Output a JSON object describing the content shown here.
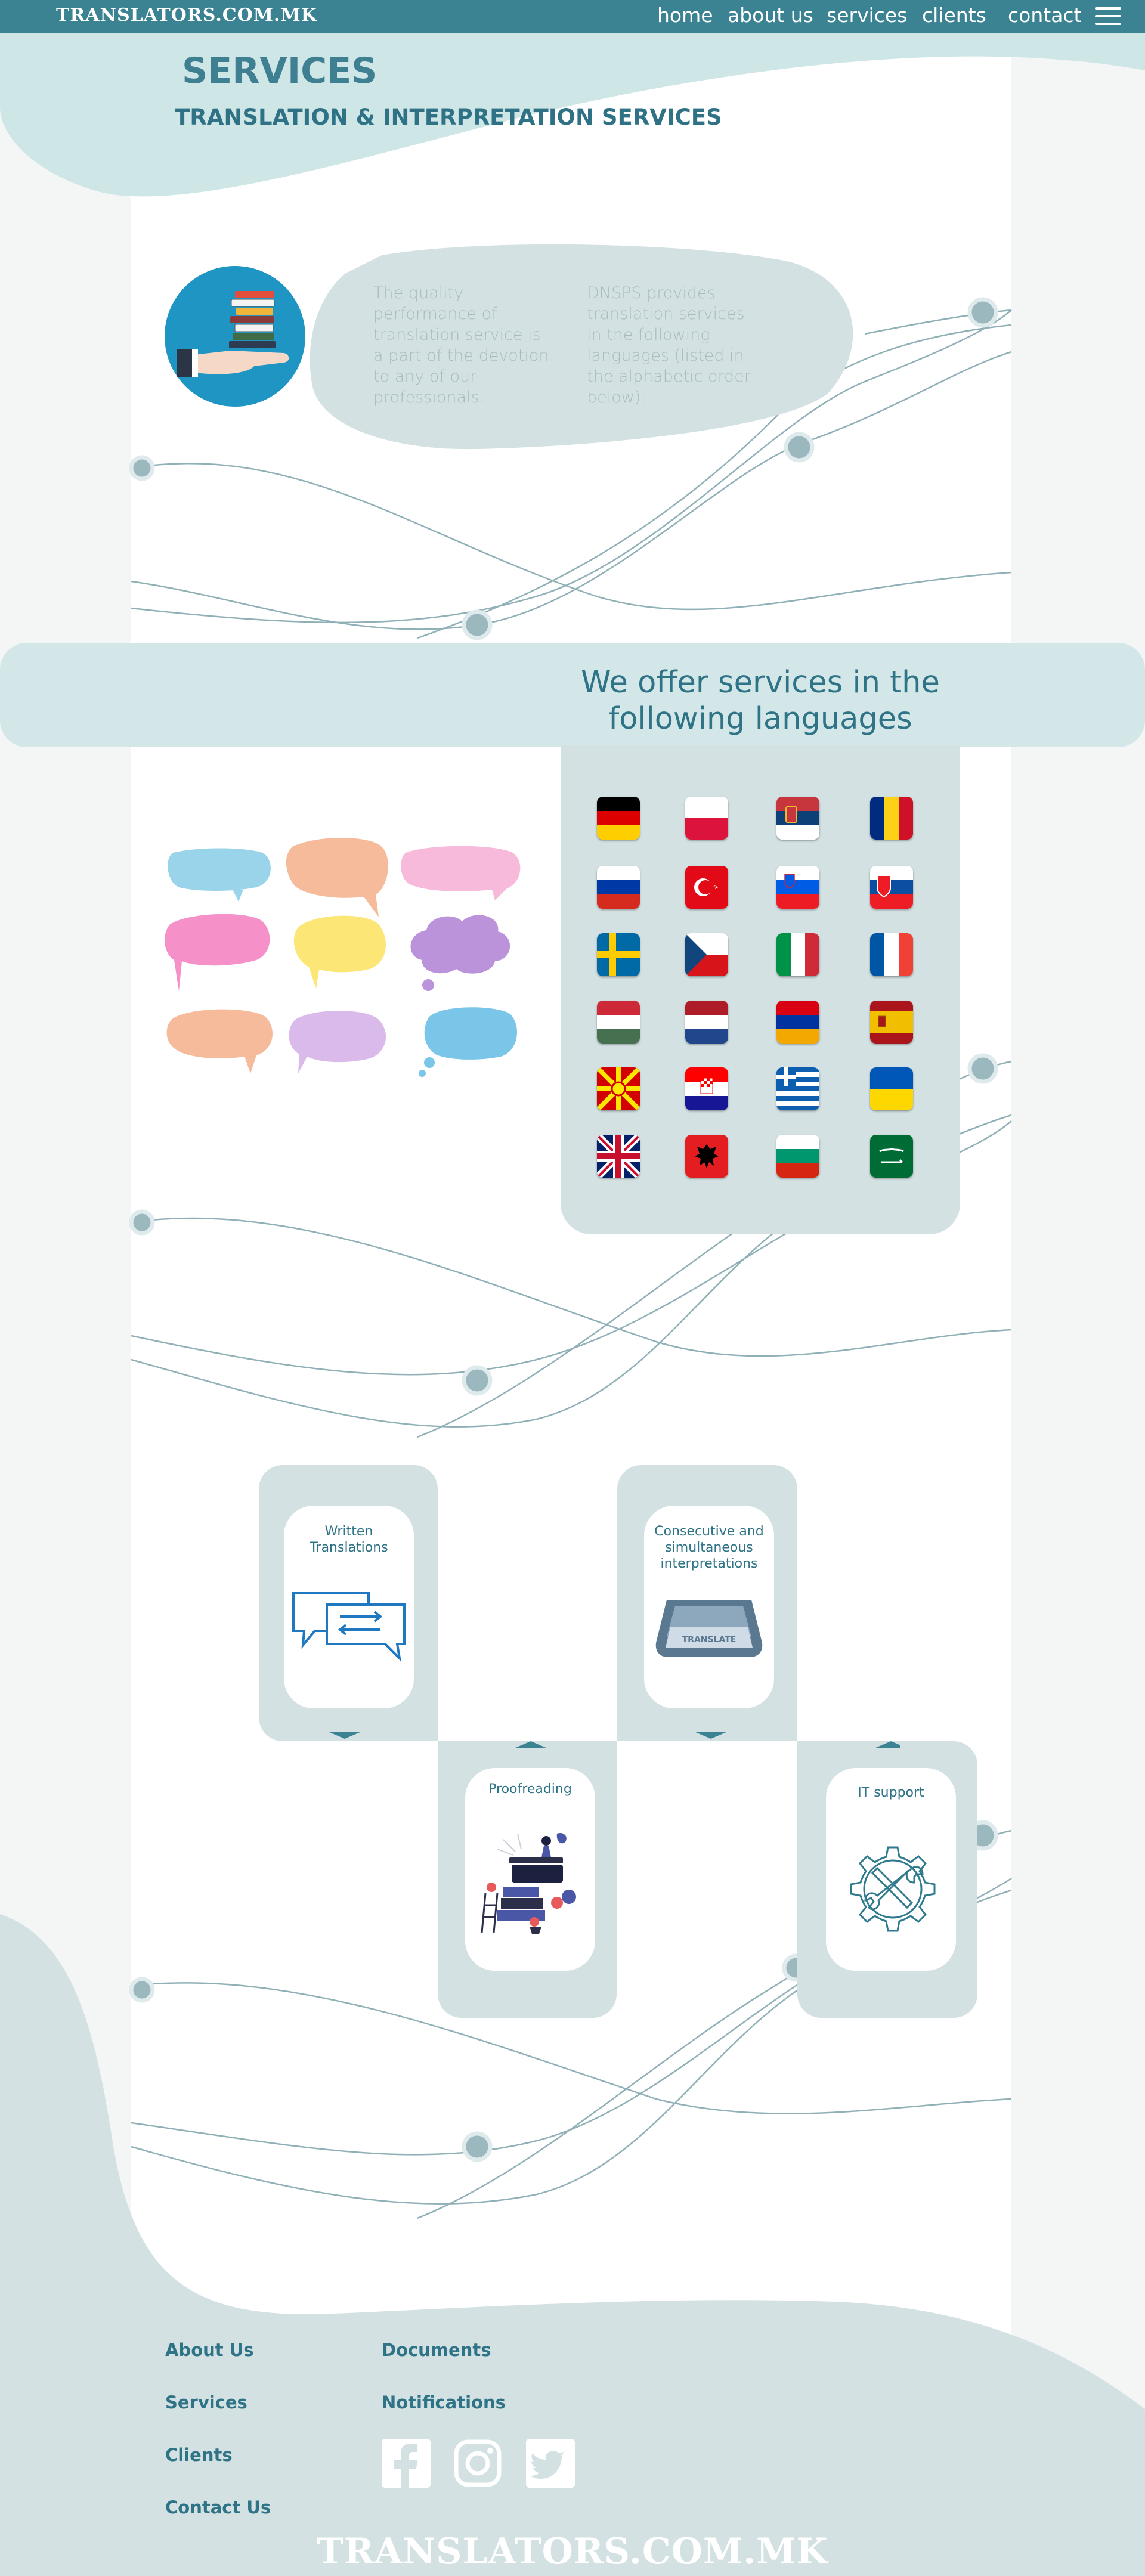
{
  "header": {
    "brand": "TRANSLATORS.COM.MK",
    "nav": [
      "home",
      "about us",
      "services",
      "clients",
      "contact"
    ]
  },
  "hero": {
    "title": "SERVICES",
    "subtitle": "TRANSLATION & INTERPRETATION SERVICES"
  },
  "intro": {
    "left_text": "The quality performance of translation service is a part of the devotion to any of our professionals.",
    "right_text": "DNSPS provides translation services in the following languages (listed in the alphabetic order below):"
  },
  "languages": {
    "heading": "We offer services in the following languages",
    "flags": [
      "germany-flag",
      "poland-flag",
      "serbia-flag",
      "romania-flag",
      "russia-flag",
      "turkey-flag",
      "slovenia-flag",
      "slovakia-flag",
      "sweden-flag",
      "czech-flag",
      "italy-flag",
      "france-flag",
      "hungary-flag",
      "netherlands-flag",
      "armenia-flag",
      "spain-flag",
      "macedonia-flag",
      "croatia-flag",
      "greece-flag",
      "ukraine-flag",
      "uk-flag",
      "albania-flag",
      "bulgaria-flag",
      "saudi-arabia-flag"
    ]
  },
  "services": {
    "written": "Written Translations",
    "interpretation": "Consecutive and simultaneous interpretations",
    "proofreading": "Proofreading",
    "it_support": "IT support",
    "translate_key": "TRANSLATE"
  },
  "footer": {
    "col1": [
      "About Us",
      "Services",
      "Clients",
      "Contact Us"
    ],
    "col2": [
      "Documents",
      "Notifications"
    ],
    "social": [
      "facebook-icon",
      "instagram-icon",
      "twitter-icon"
    ],
    "brand": "TRANSLATORS.COM.MK"
  },
  "colors": {
    "header": "#3b8393",
    "wave": "#cfe6e7",
    "panel": "#d3e1e2",
    "text": "#2e7386",
    "line": "#8fb0b6"
  }
}
